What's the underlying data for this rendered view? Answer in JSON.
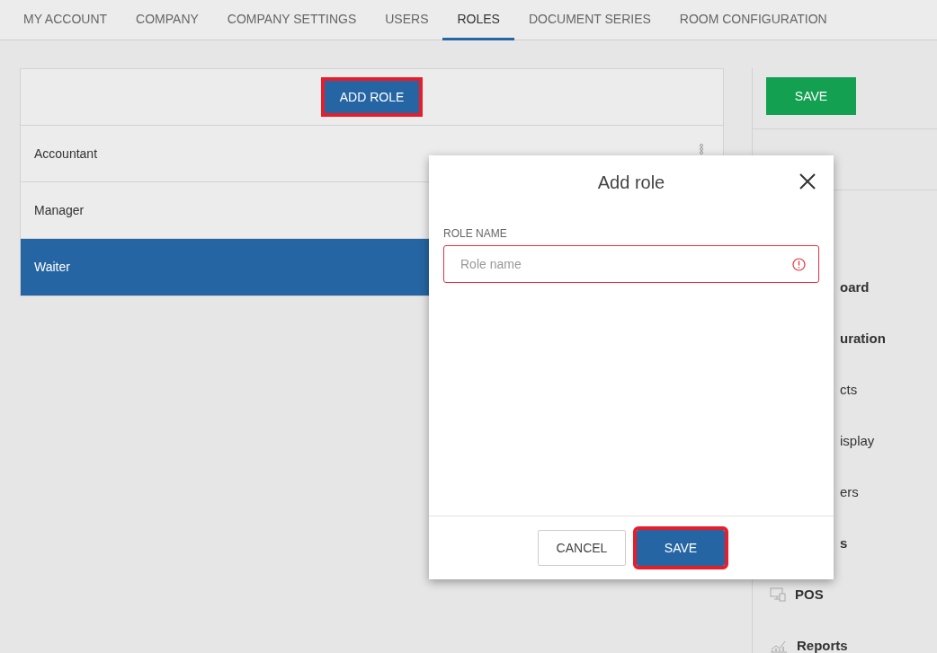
{
  "tabs": [
    {
      "label": "MY ACCOUNT",
      "selected": false
    },
    {
      "label": "COMPANY",
      "selected": false
    },
    {
      "label": "COMPANY SETTINGS",
      "selected": false
    },
    {
      "label": "USERS",
      "selected": false
    },
    {
      "label": "ROLES",
      "selected": true
    },
    {
      "label": "DOCUMENT SERIES",
      "selected": false
    },
    {
      "label": "ROOM CONFIGURATION",
      "selected": false
    }
  ],
  "roles_panel": {
    "add_button": "ADD ROLE",
    "highlighted": true,
    "roles": [
      {
        "name": "Accountant",
        "selected": false
      },
      {
        "name": "Manager",
        "selected": false
      },
      {
        "name": "Waiter",
        "selected": true
      }
    ]
  },
  "permissions_panel": {
    "save_button": "SAVE",
    "items": [
      {
        "label": "oard",
        "bold": true,
        "covered": true
      },
      {
        "label": "uration",
        "bold": true,
        "covered": true
      },
      {
        "label": "cts",
        "bold": false,
        "covered": true
      },
      {
        "label": "isplay",
        "bold": false,
        "covered": true
      },
      {
        "label": "ers",
        "bold": false,
        "covered": true
      },
      {
        "label": "s",
        "bold": true,
        "covered": true
      },
      {
        "label": "POS",
        "bold": true,
        "covered": false
      },
      {
        "label": "Reports",
        "bold": true,
        "covered": false
      }
    ]
  },
  "dialog": {
    "title": "Add role",
    "field_label": "ROLE NAME",
    "placeholder": "Role name",
    "error": true,
    "buttons": [
      {
        "label": "CANCEL",
        "kind": "secondary",
        "highlighted": false
      },
      {
        "label": "SAVE",
        "kind": "primary",
        "highlighted": true
      }
    ]
  }
}
